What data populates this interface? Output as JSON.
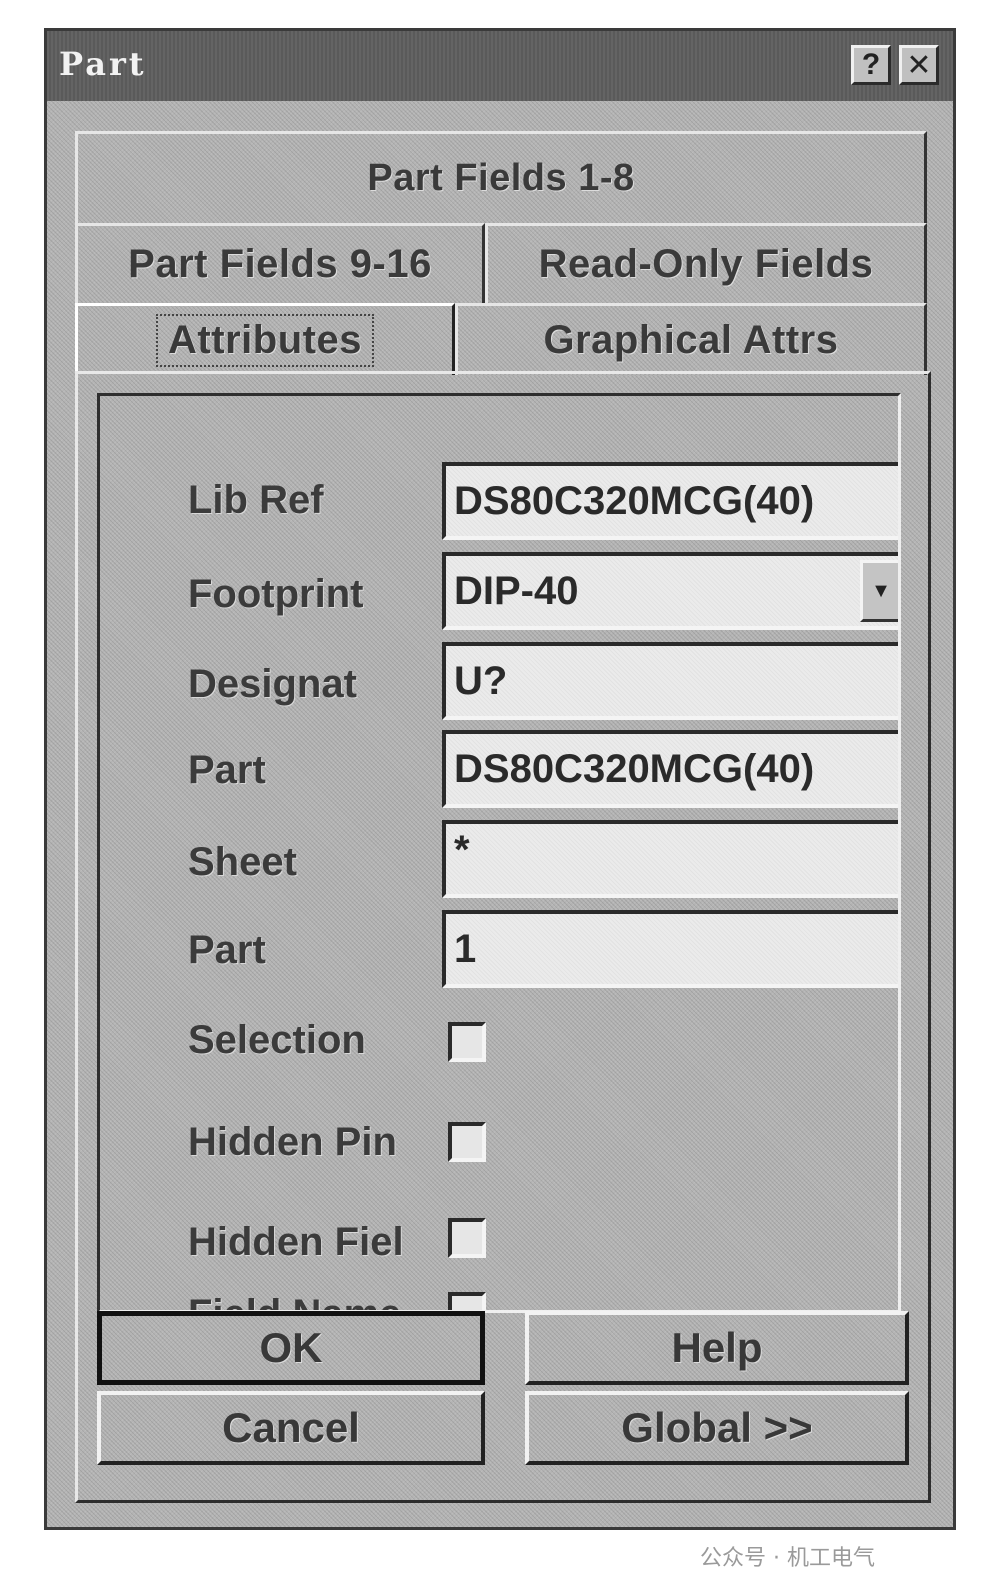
{
  "window": {
    "title": "Part",
    "help_glyph": "?",
    "close_glyph": "✕"
  },
  "tabs": {
    "part_fields_1_8": "Part Fields 1-8",
    "part_fields_9_16": "Part Fields 9-16",
    "read_only_fields": "Read-Only Fields",
    "attributes": "Attributes",
    "graphical_attrs": "Graphical Attrs",
    "active": "Attributes"
  },
  "fields": {
    "lib_ref": {
      "label": "Lib Ref",
      "value": "DS80C320MCG(40)"
    },
    "footprint": {
      "label": "Footprint",
      "value": "DIP-40"
    },
    "designator": {
      "label": "Designat",
      "value": "U?"
    },
    "part_type": {
      "label": "Part",
      "value": "DS80C320MCG(40)"
    },
    "sheet": {
      "label": "Sheet",
      "value": "*"
    },
    "part_no": {
      "label": "Part",
      "value": "1"
    }
  },
  "checkboxes": {
    "selection": {
      "label": "Selection",
      "checked": false
    },
    "hidden_pins": {
      "label": "Hidden Pin",
      "checked": false
    },
    "hidden_fields": {
      "label": "Hidden Fiel",
      "checked": false
    },
    "field_names": {
      "label": "Field Name",
      "checked": false
    }
  },
  "buttons": {
    "ok": "OK",
    "help": "Help",
    "cancel": "Cancel",
    "global": "Global >>"
  },
  "icons": {
    "dropdown": "chevron-down-icon",
    "dropdown_glyph": "▼"
  },
  "watermark": "公众号 · 机工电气"
}
